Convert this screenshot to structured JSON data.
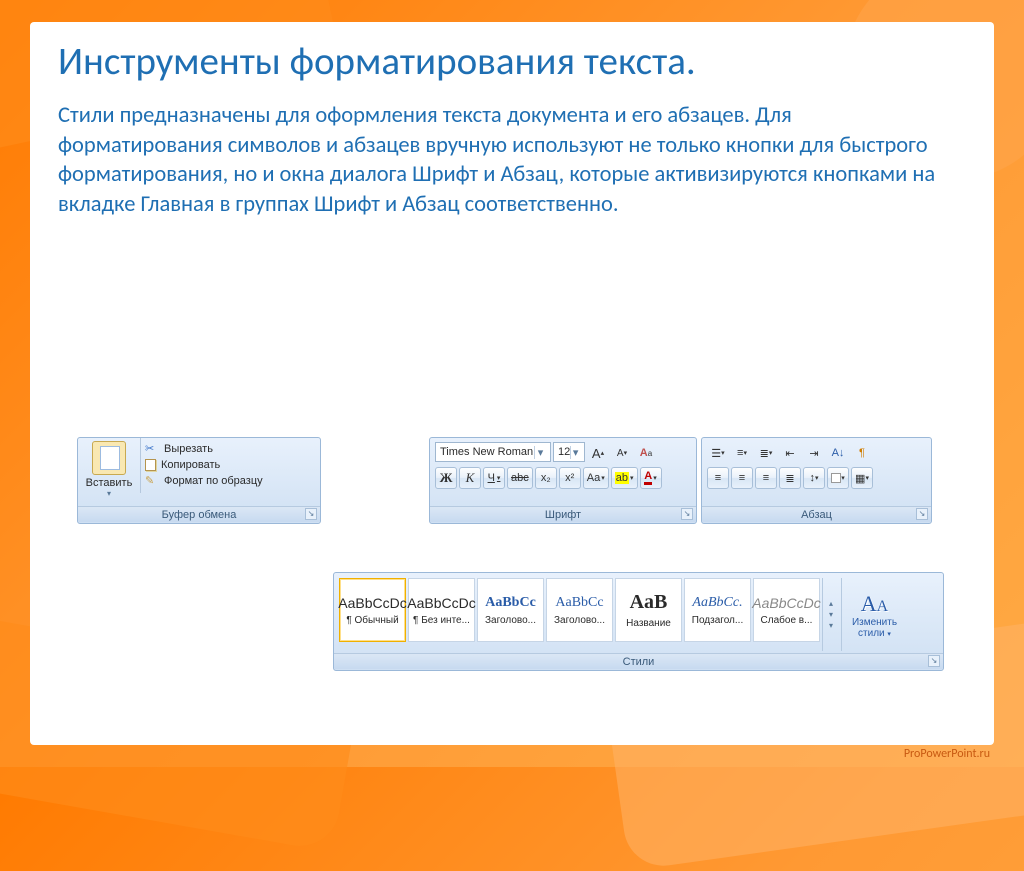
{
  "slide": {
    "title": "Инструменты форматирования текста.",
    "body": "Стили предназначены для оформления текста документа и его абзацев. Для форматирования символов и абзацев вручную используют не только кнопки для быстрого форматирования, но и окна диалога Шрифт и Абзац, которые активизируются кнопками на вкладке Главная в группах Шрифт и Абзац соответственно."
  },
  "clipboard": {
    "paste": "Вставить",
    "cut": "Вырезать",
    "copy": "Копировать",
    "format_painter": "Формат по образцу",
    "group": "Буфер обмена"
  },
  "font": {
    "name": "Times New Roman",
    "size": "12",
    "grow": "A",
    "shrink": "A",
    "clear": "Aa",
    "bold": "Ж",
    "italic": "К",
    "underline": "Ч",
    "strike": "abc",
    "sub": "x₂",
    "sup": "x²",
    "case": "Aa",
    "highlight": "ab",
    "color": "A",
    "group": "Шрифт"
  },
  "para": {
    "group": "Абзац"
  },
  "styles": {
    "items": [
      {
        "sample": "AaBbCcDc",
        "name": "¶ Обычный",
        "cls": ""
      },
      {
        "sample": "AaBbCcDc",
        "name": "¶ Без инте...",
        "cls": ""
      },
      {
        "sample": "AaBbCc",
        "name": "Заголово...",
        "cls": "serif blue b"
      },
      {
        "sample": "AaBbCc",
        "name": "Заголово...",
        "cls": "serif blue"
      },
      {
        "sample": "AaB",
        "name": "Название",
        "cls": "serif b",
        "big": true
      },
      {
        "sample": "AaBbCc.",
        "name": "Подзагол...",
        "cls": "serif blue ital"
      },
      {
        "sample": "AaBbCcDc",
        "name": "Слабое в...",
        "cls": "ital",
        "grey": true
      }
    ],
    "change": "Изменить стили",
    "group": "Стили"
  },
  "watermark": "ProPowerPoint.ru"
}
